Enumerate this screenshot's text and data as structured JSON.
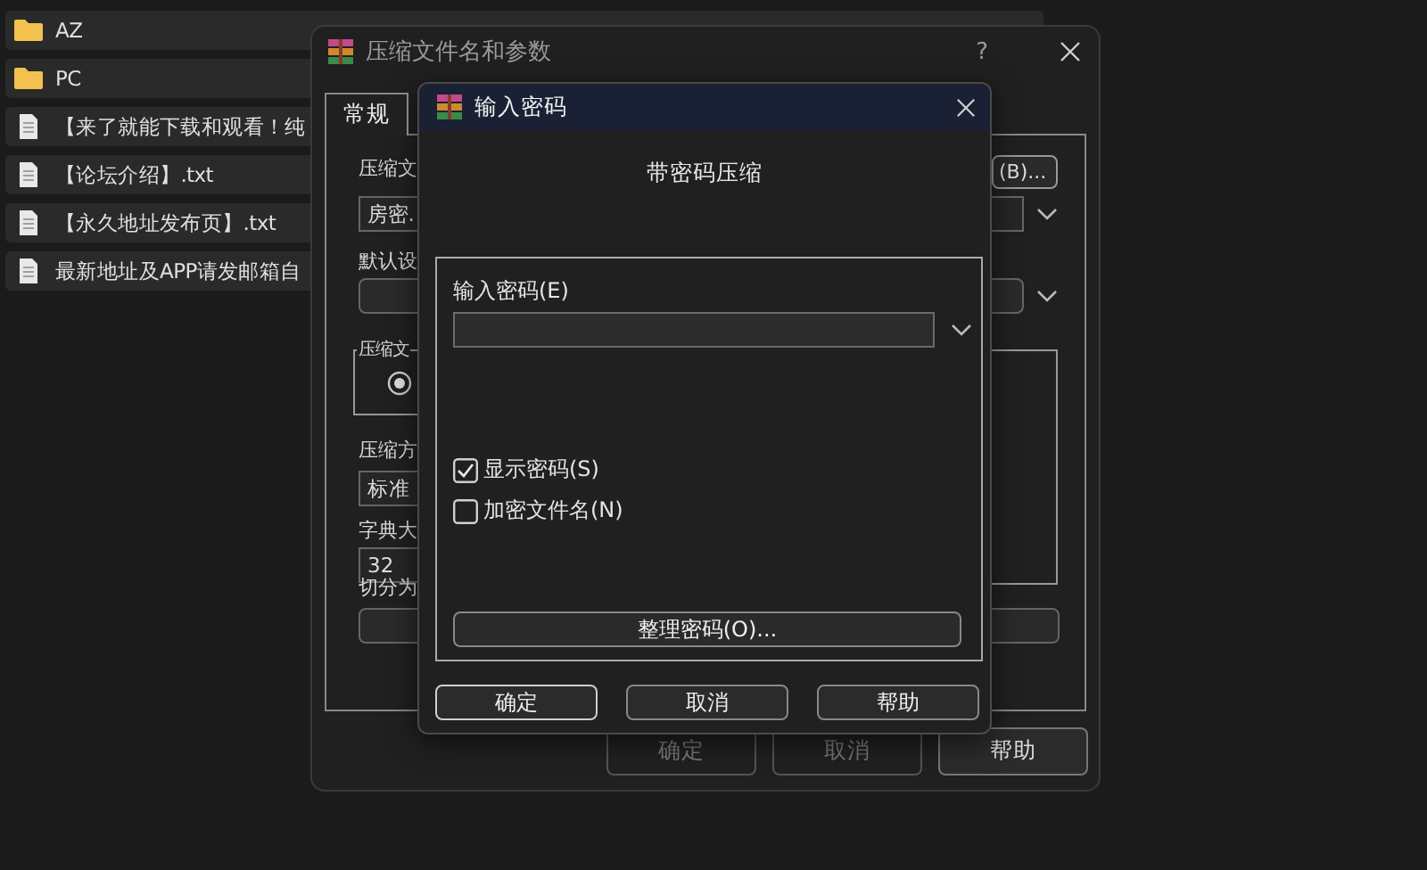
{
  "file_list": [
    {
      "kind": "folder",
      "name": "AZ"
    },
    {
      "kind": "folder",
      "name": "PC"
    },
    {
      "kind": "text",
      "name": "【来了就能下载和观看！纯"
    },
    {
      "kind": "text",
      "name": "【论坛介绍】.txt"
    },
    {
      "kind": "text",
      "name": "【永久地址发布页】.txt"
    },
    {
      "kind": "text",
      "name": "最新地址及APP请发邮箱自"
    }
  ],
  "back_dialog": {
    "title": "压缩文件名和参数",
    "help": "?",
    "tab": {
      "label": "常规",
      "selected": true
    },
    "archive_name": {
      "label": "压缩文",
      "browse_button": "(B)...",
      "value": "房密."
    },
    "profile": {
      "label": "默认设"
    },
    "format_group": {
      "label": "压缩文",
      "radio_selected": true
    },
    "method": {
      "label": "压缩方",
      "value": "标准"
    },
    "dictionary": {
      "label": "字典大",
      "value": "32"
    },
    "split": {
      "label": "切分为"
    },
    "buttons": [
      {
        "label": "确定",
        "disabled": true
      },
      {
        "label": "取消",
        "disabled": true
      },
      {
        "label": "帮助",
        "disabled": false
      }
    ]
  },
  "password_dialog": {
    "title": "输入密码",
    "heading": "带密码压缩",
    "password": {
      "label": "输入密码(E)"
    },
    "options": [
      {
        "label": "显示密码(S)",
        "checked": true
      },
      {
        "label": "加密文件名(N)",
        "checked": false
      }
    ],
    "organize_button": "整理密码(O)...",
    "buttons": [
      {
        "label": "确定",
        "default": true
      },
      {
        "label": "取消",
        "default": false
      },
      {
        "label": "帮助",
        "default": false
      }
    ]
  }
}
